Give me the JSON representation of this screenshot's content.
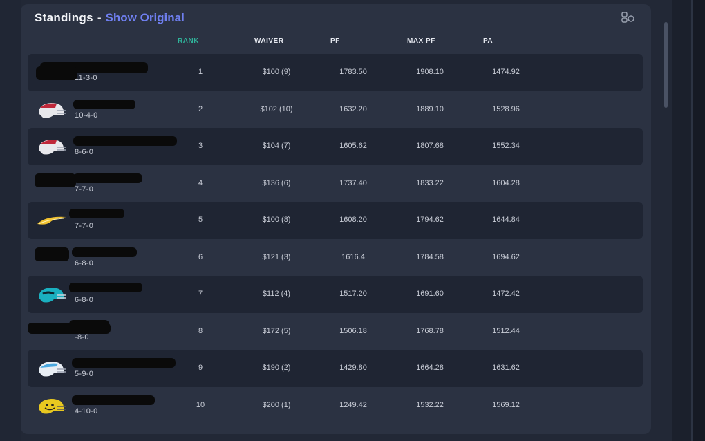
{
  "header": {
    "title": "Standings",
    "separator": "-",
    "show_original": "Show Original"
  },
  "columns": {
    "rank": "RANK",
    "waiver": "WAIVER",
    "pf": "PF",
    "max_pf": "MAX PF",
    "pa": "PA"
  },
  "colors": {
    "accent_rank": "#2fb39a",
    "link": "#6f7ff0",
    "panel": "#2b3242",
    "row_dark": "#1f2533"
  },
  "rows": [
    {
      "record": "11-3-0",
      "rank": "1",
      "waiver": "$100 (9)",
      "pf": "1783.50",
      "max_pf": "1908.10",
      "pa": "1474.92",
      "logo": "none"
    },
    {
      "record": "10-4-0",
      "rank": "2",
      "waiver": "$102 (10)",
      "pf": "1632.20",
      "max_pf": "1889.10",
      "pa": "1528.96",
      "logo": "red-white-helmet-icon"
    },
    {
      "record": "8-6-0",
      "rank": "3",
      "waiver": "$104 (7)",
      "pf": "1605.62",
      "max_pf": "1807.68",
      "pa": "1552.34",
      "logo": "red-white-helmet-icon"
    },
    {
      "record": "7-7-0",
      "rank": "4",
      "waiver": "$136 (6)",
      "pf": "1737.40",
      "max_pf": "1833.22",
      "pa": "1604.28",
      "logo": "none"
    },
    {
      "record": "7-7-0",
      "rank": "5",
      "waiver": "$100 (8)",
      "pf": "1608.20",
      "max_pf": "1794.62",
      "pa": "1644.84",
      "logo": "lightning-bolt-icon"
    },
    {
      "record": "6-8-0",
      "rank": "6",
      "waiver": "$121 (3)",
      "pf": "1616.4",
      "max_pf": "1784.58",
      "pa": "1694.62",
      "logo": "none"
    },
    {
      "record": "6-8-0",
      "rank": "7",
      "waiver": "$112 (4)",
      "pf": "1517.20",
      "max_pf": "1691.60",
      "pa": "1472.42",
      "logo": "teal-helmet-icon"
    },
    {
      "record": "-8-0",
      "rank": "8",
      "waiver": "$172 (5)",
      "pf": "1506.18",
      "max_pf": "1768.78",
      "pa": "1512.44",
      "logo": "none"
    },
    {
      "record": "5-9-0",
      "rank": "9",
      "waiver": "$190 (2)",
      "pf": "1429.80",
      "max_pf": "1664.28",
      "pa": "1631.62",
      "logo": "light-blue-helmet-icon"
    },
    {
      "record": "4-10-0",
      "rank": "10",
      "waiver": "$200 (1)",
      "pf": "1249.42",
      "max_pf": "1532.22",
      "pa": "1569.12",
      "logo": "yellow-smiley-helmet-icon"
    }
  ]
}
